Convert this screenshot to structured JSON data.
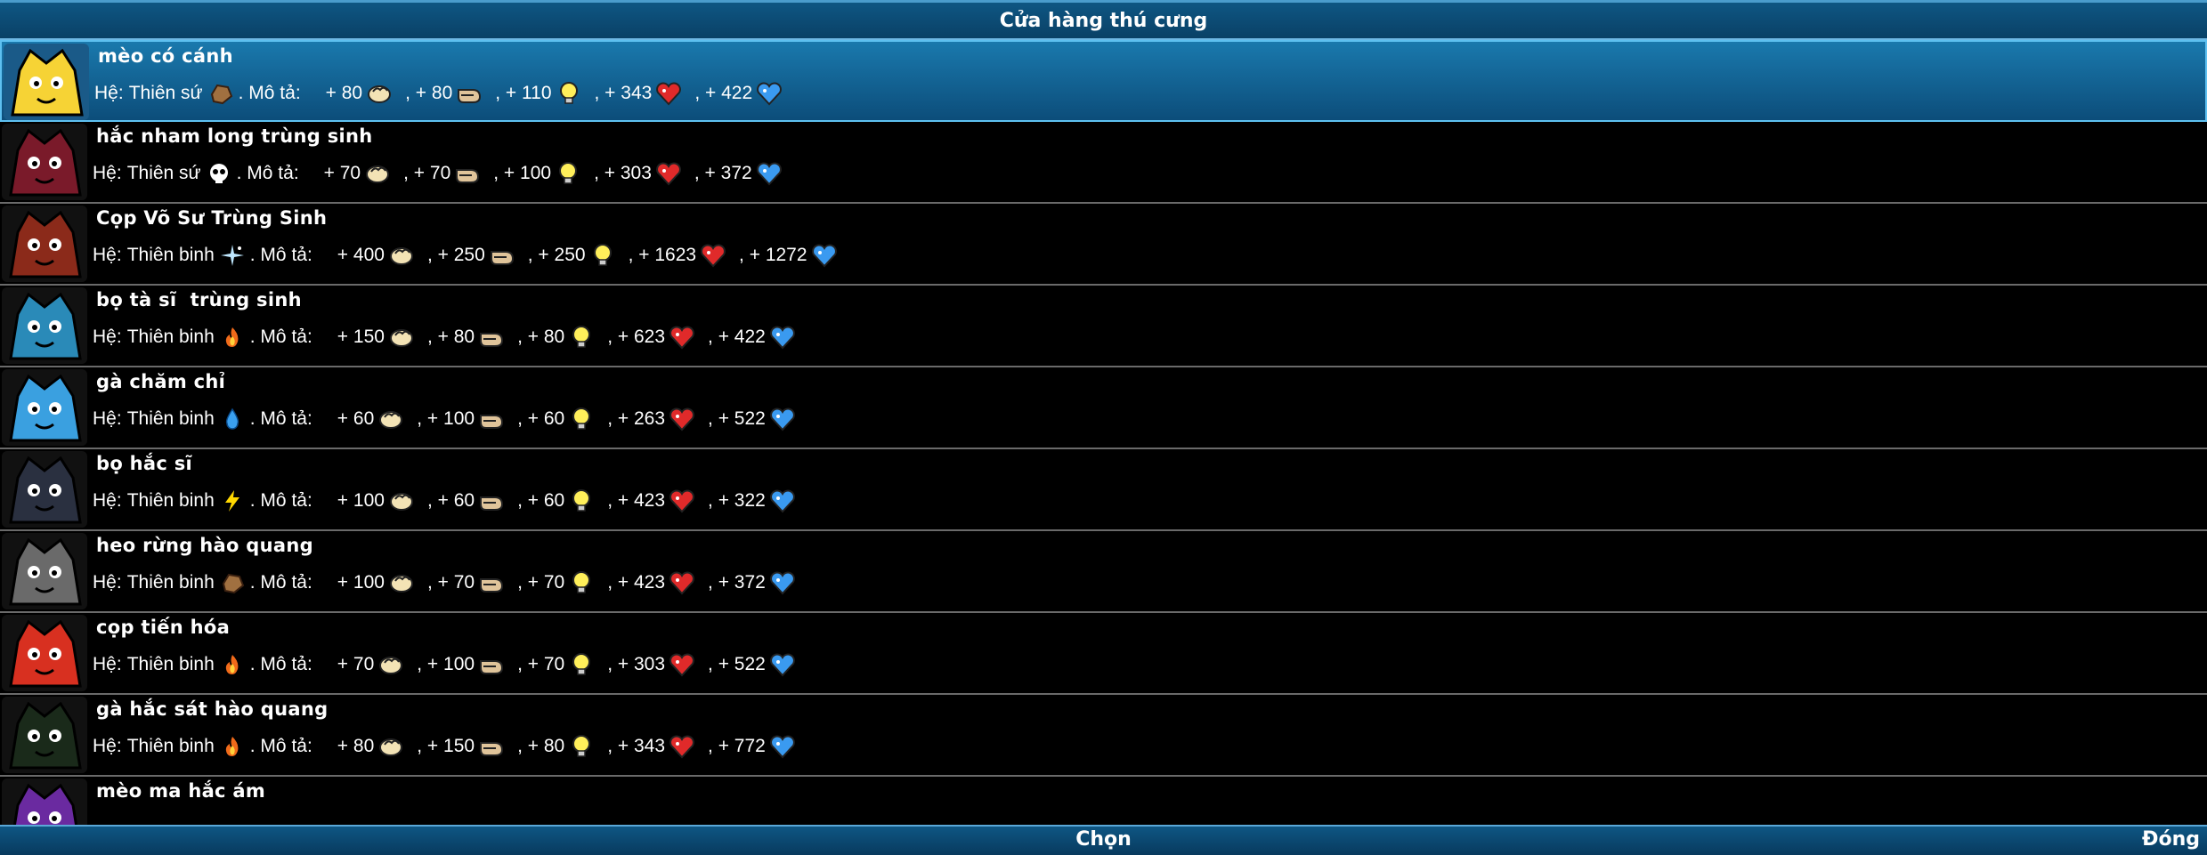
{
  "title": "Cửa hàng thú cưng",
  "footer": {
    "choose_label": "Chọn",
    "close_label": "Đóng"
  },
  "labels": {
    "he": "Hệ:",
    "mota": ". Mô tả:"
  },
  "colors": {
    "titlebar": "#0e5683",
    "selected_row": "#1a79ad",
    "separator": "#6a6a6a"
  },
  "pets": [
    {
      "name": "mèo có cánh",
      "class": "Thiên sứ",
      "element_icon": "rock-icon",
      "selected": true,
      "stats": [
        "+ 80",
        ", + 80",
        ", + 110",
        ", + 343",
        ", + 422"
      ]
    },
    {
      "name": "hắc nham long trùng sinh",
      "class": "Thiên sứ",
      "element_icon": "skull-icon",
      "selected": false,
      "stats": [
        "+ 70",
        ", + 70",
        ", + 100",
        ", + 303",
        ", + 372"
      ]
    },
    {
      "name": "Cọp Võ Sư Trùng Sinh",
      "class": "Thiên binh",
      "element_icon": "sparkle-icon",
      "selected": false,
      "stats": [
        "+ 400",
        ", + 250",
        ", + 250",
        ", + 1623",
        ", + 1272"
      ]
    },
    {
      "name": "bọ tà sĩ  trùng sinh",
      "class": "Thiên binh",
      "element_icon": "fire-icon",
      "selected": false,
      "stats": [
        "+ 150",
        ", + 80",
        ", + 80",
        ", + 623",
        ", + 422"
      ]
    },
    {
      "name": "gà chăm chỉ",
      "class": "Thiên binh",
      "element_icon": "water-drop-icon",
      "selected": false,
      "stats": [
        "+ 60",
        ", + 100",
        ", + 60",
        ", + 263",
        ", + 522"
      ]
    },
    {
      "name": "bọ hắc sĩ",
      "class": "Thiên binh",
      "element_icon": "lightning-icon",
      "selected": false,
      "stats": [
        "+ 100",
        ", + 60",
        ", + 60",
        ", + 423",
        ", + 322"
      ]
    },
    {
      "name": "heo rừng hào quang",
      "class": "Thiên binh",
      "element_icon": "rock-icon",
      "selected": false,
      "stats": [
        "+ 100",
        ", + 70",
        ", + 70",
        ", + 423",
        ", + 372"
      ]
    },
    {
      "name": "cọp tiến hóa",
      "class": "Thiên binh",
      "element_icon": "fire-icon",
      "selected": false,
      "stats": [
        "+ 70",
        ", + 100",
        ", + 70",
        ", + 303",
        ", + 522"
      ]
    },
    {
      "name": "gà hắc sát hào quang",
      "class": "Thiên binh",
      "element_icon": "fire-icon",
      "selected": false,
      "stats": [
        "+ 80",
        ", + 150",
        ", + 80",
        ", + 343",
        ", + 772"
      ]
    },
    {
      "name": "mèo ma hắc ám",
      "class": "",
      "element_icon": "",
      "selected": false,
      "stats": []
    }
  ],
  "stat_icons": [
    "fist-icon",
    "kick-icon",
    "lightbulb-icon",
    "red-heart-icon",
    "blue-heart-icon"
  ],
  "avatar_colors": [
    "#f6d335",
    "#7a1a2a",
    "#8b2a1a",
    "#2a8ab8",
    "#3aa0e0",
    "#2a3040",
    "#6a6a6a",
    "#d83020",
    "#1a2a1a",
    "#6a2aa0"
  ]
}
